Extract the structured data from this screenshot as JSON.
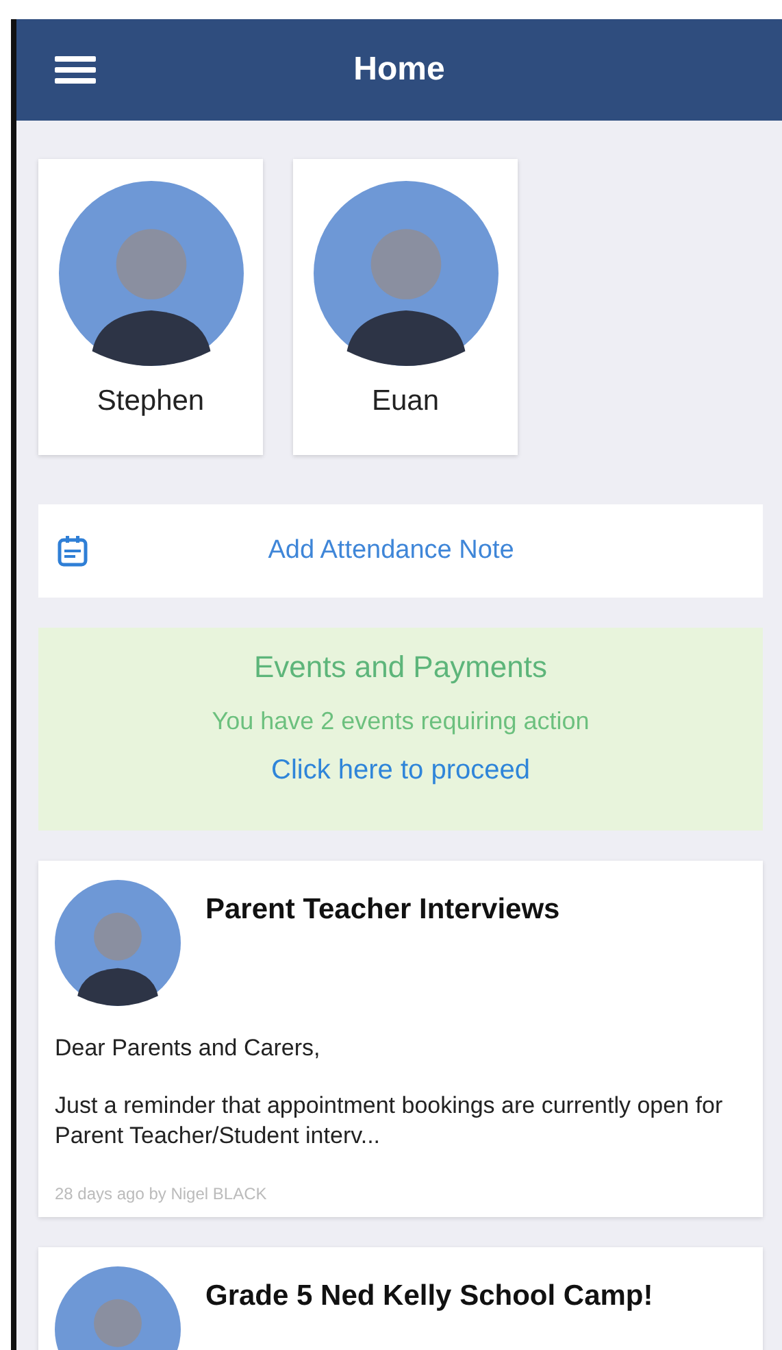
{
  "header": {
    "title": "Home"
  },
  "children": [
    {
      "name": "Stephen"
    },
    {
      "name": "Euan"
    }
  ],
  "attendance": {
    "label": "Add Attendance Note"
  },
  "events": {
    "title": "Events and Payments",
    "message": "You have 2 events requiring action",
    "link": "Click here to proceed"
  },
  "posts": [
    {
      "title": "Parent Teacher Interviews",
      "paragraphs": [
        "Dear Parents and Carers,",
        "Just a reminder that appointment bookings are currently open for Parent Teacher/Student interv..."
      ],
      "meta": "28 days ago by Nigel BLACK"
    },
    {
      "title": "Grade 5 Ned Kelly School Camp!"
    }
  ]
}
